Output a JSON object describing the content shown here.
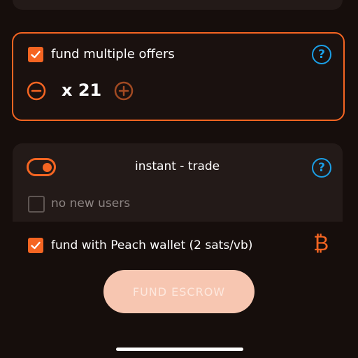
{
  "multiple_offers": {
    "label": "fund multiple offers",
    "checked": true,
    "count_text": "x 21",
    "help_symbol": "?"
  },
  "trade": {
    "label": "instant - trade",
    "toggle_on": true,
    "help_symbol": "?",
    "no_new_users_label": "no new users",
    "no_new_users_checked": false
  },
  "peach_wallet": {
    "label": "fund with Peach wallet (2 sats/vb)",
    "checked": true,
    "currency_icon": "bitcoin-icon",
    "currency_symbol": "₿"
  },
  "fund_button": {
    "label": "FUND ESCROW",
    "disabled": true
  },
  "colors": {
    "accent": "#f56522",
    "help": "#1b9fe6",
    "background": "#160e0c",
    "card": "#231a18",
    "button": "#f7c6b1"
  }
}
